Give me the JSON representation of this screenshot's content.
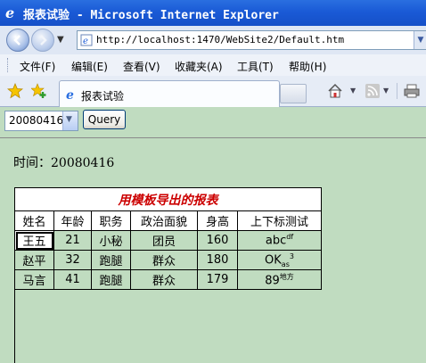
{
  "window": {
    "title": "报表试验 - Microsoft Internet Explorer"
  },
  "address_bar": {
    "url": "http://localhost:1470/WebSite2/Default.htm"
  },
  "menu": {
    "items": [
      "文件(F)",
      "编辑(E)",
      "查看(V)",
      "收藏夹(A)",
      "工具(T)",
      "帮助(H)"
    ]
  },
  "tab": {
    "label": "报表试验"
  },
  "controls": {
    "date_selected": "20080416",
    "query_label": "Query"
  },
  "time_label": "时间：20080416",
  "report": {
    "title": "用模板导出的报表",
    "headers": [
      "姓名",
      "年龄",
      "职务",
      "政治面貌",
      "身高",
      "上下标测试"
    ],
    "rows": [
      {
        "name": "王五",
        "age": "21",
        "job": "小秘",
        "politics": "团员",
        "height": "160",
        "test_base": "abc",
        "test_sup": "df",
        "test_sub": ""
      },
      {
        "name": "赵平",
        "age": "32",
        "job": "跑腿",
        "politics": "群众",
        "height": "180",
        "test_base": "OK",
        "test_sub": "as",
        "test_sup": "3"
      },
      {
        "name": "马言",
        "age": "41",
        "job": "跑腿",
        "politics": "群众",
        "height": "179",
        "test_base": "89",
        "test_sup": "地方",
        "test_sub": ""
      }
    ]
  },
  "colors": {
    "page_bg": "#c0dcc0",
    "title_red": "#cc0000",
    "titlebar_blue": "#1a5ad6"
  }
}
